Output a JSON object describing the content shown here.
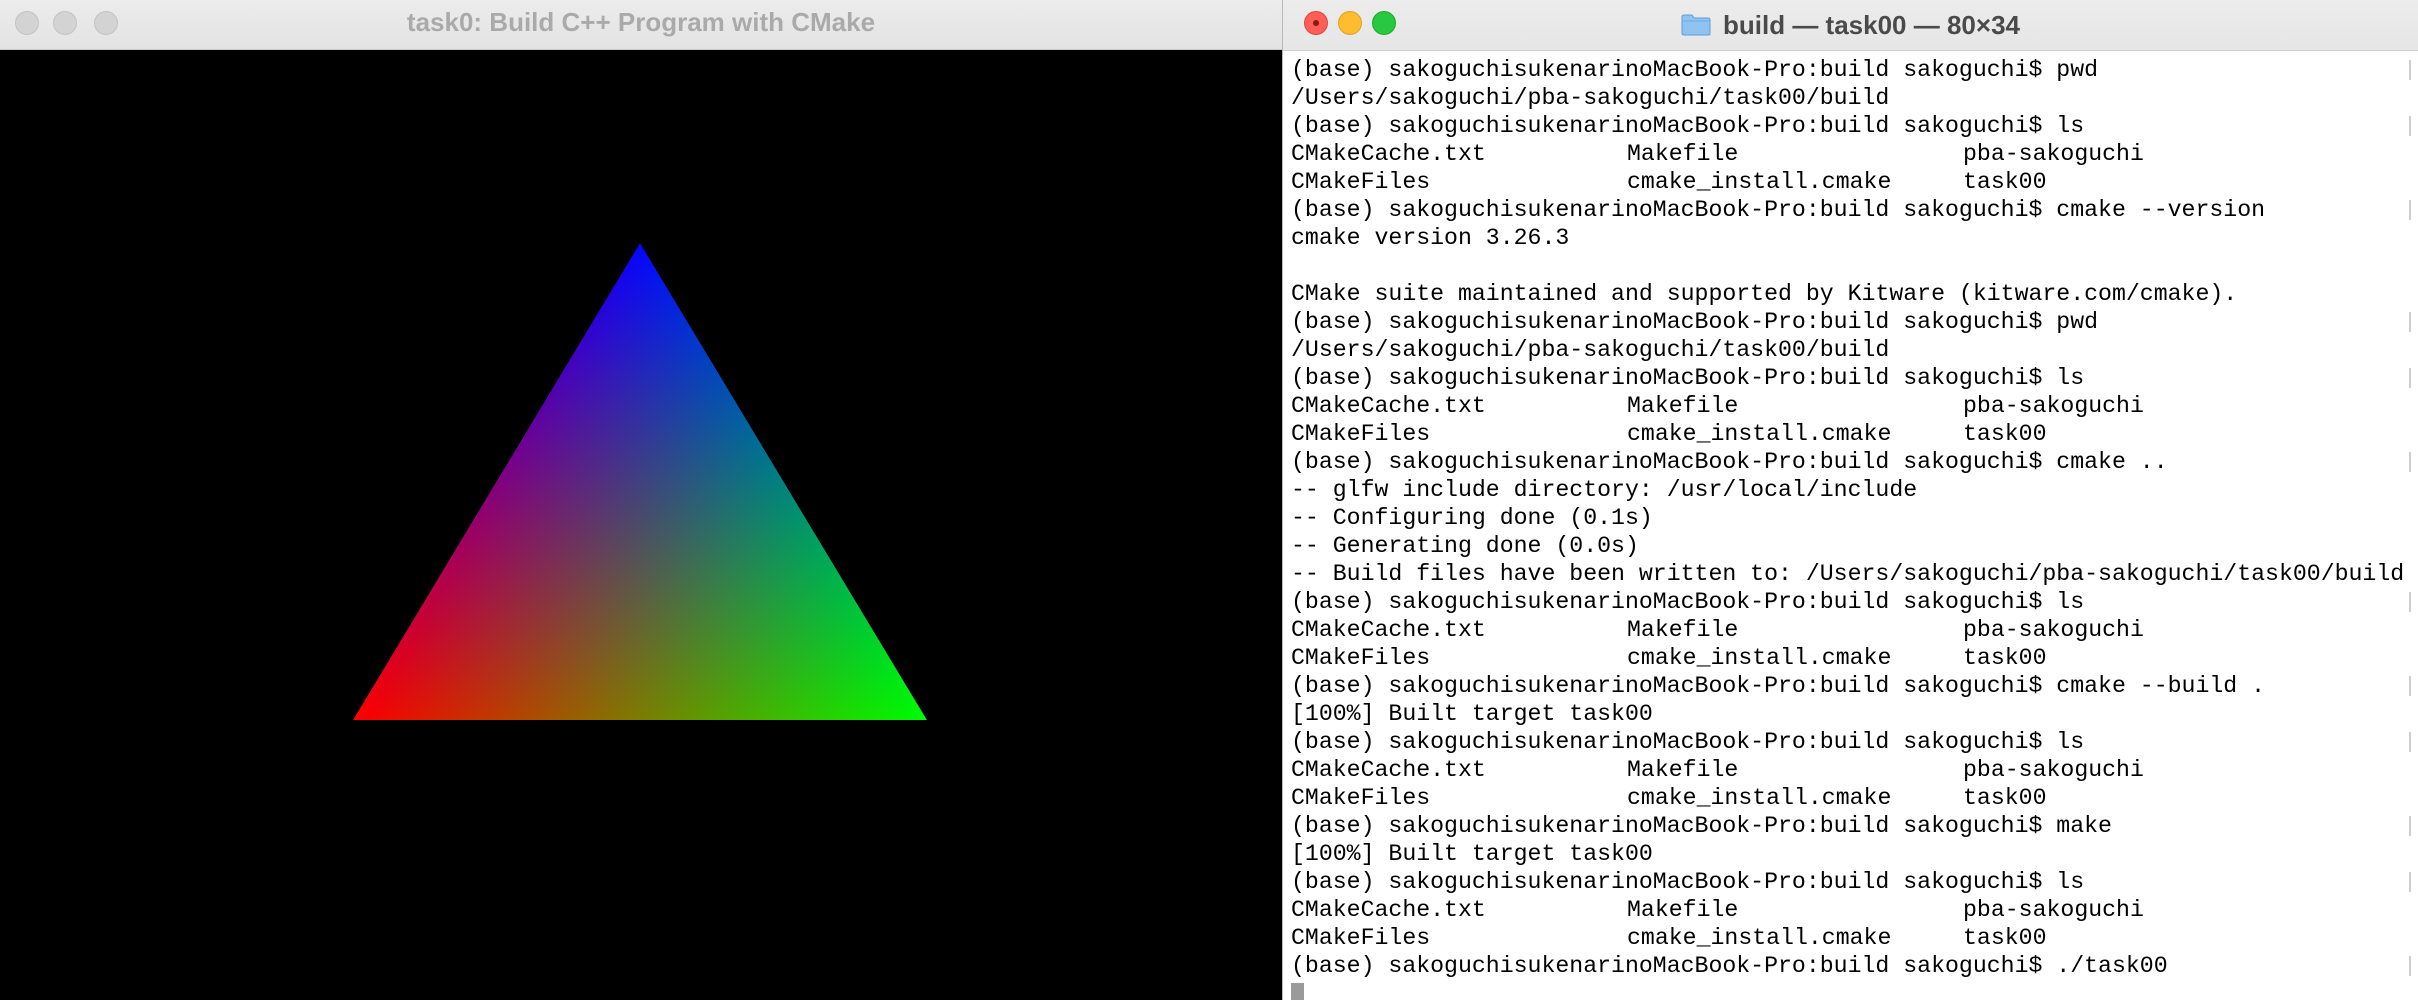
{
  "gl_window": {
    "title": "task0: Build C++ Program with CMake",
    "triangle": {
      "vertex_colors": {
        "top": "#0000ff",
        "left": "#ff0000",
        "right": "#00ff00"
      }
    },
    "background": "#000000"
  },
  "terminal": {
    "title": "build — task00 — 80×34",
    "title_icon": "folder-icon",
    "lines": [
      {
        "type": "prompt",
        "text": "(base) sakoguchisukenarinoMacBook-Pro:build sakoguchi$ pwd"
      },
      {
        "type": "output",
        "text": "/Users/sakoguchi/pba-sakoguchi/task00/build"
      },
      {
        "type": "prompt",
        "text": "(base) sakoguchisukenarinoMacBook-Pro:build sakoguchi$ ls"
      },
      {
        "type": "ls",
        "cells": [
          "CMakeCache.txt",
          "Makefile",
          "pba-sakoguchi"
        ]
      },
      {
        "type": "ls",
        "cells": [
          "CMakeFiles",
          "cmake_install.cmake",
          "task00"
        ]
      },
      {
        "type": "prompt",
        "text": "(base) sakoguchisukenarinoMacBook-Pro:build sakoguchi$ cmake --version"
      },
      {
        "type": "output",
        "text": "cmake version 3.26.3"
      },
      {
        "type": "output",
        "text": ""
      },
      {
        "type": "output",
        "text": "CMake suite maintained and supported by Kitware (kitware.com/cmake)."
      },
      {
        "type": "prompt",
        "text": "(base) sakoguchisukenarinoMacBook-Pro:build sakoguchi$ pwd"
      },
      {
        "type": "output",
        "text": "/Users/sakoguchi/pba-sakoguchi/task00/build"
      },
      {
        "type": "prompt",
        "text": "(base) sakoguchisukenarinoMacBook-Pro:build sakoguchi$ ls"
      },
      {
        "type": "ls",
        "cells": [
          "CMakeCache.txt",
          "Makefile",
          "pba-sakoguchi"
        ]
      },
      {
        "type": "ls",
        "cells": [
          "CMakeFiles",
          "cmake_install.cmake",
          "task00"
        ]
      },
      {
        "type": "prompt",
        "text": "(base) sakoguchisukenarinoMacBook-Pro:build sakoguchi$ cmake .."
      },
      {
        "type": "output",
        "text": "-- glfw include directory: /usr/local/include"
      },
      {
        "type": "output",
        "text": "-- Configuring done (0.1s)"
      },
      {
        "type": "output",
        "text": "-- Generating done (0.0s)"
      },
      {
        "type": "output",
        "text": "-- Build files have been written to: /Users/sakoguchi/pba-sakoguchi/task00/build"
      },
      {
        "type": "prompt",
        "text": "(base) sakoguchisukenarinoMacBook-Pro:build sakoguchi$ ls"
      },
      {
        "type": "ls",
        "cells": [
          "CMakeCache.txt",
          "Makefile",
          "pba-sakoguchi"
        ]
      },
      {
        "type": "ls",
        "cells": [
          "CMakeFiles",
          "cmake_install.cmake",
          "task00"
        ]
      },
      {
        "type": "prompt",
        "text": "(base) sakoguchisukenarinoMacBook-Pro:build sakoguchi$ cmake --build ."
      },
      {
        "type": "output",
        "text": "[100%] Built target task00"
      },
      {
        "type": "prompt",
        "text": "(base) sakoguchisukenarinoMacBook-Pro:build sakoguchi$ ls"
      },
      {
        "type": "ls",
        "cells": [
          "CMakeCache.txt",
          "Makefile",
          "pba-sakoguchi"
        ]
      },
      {
        "type": "ls",
        "cells": [
          "CMakeFiles",
          "cmake_install.cmake",
          "task00"
        ]
      },
      {
        "type": "prompt",
        "text": "(base) sakoguchisukenarinoMacBook-Pro:build sakoguchi$ make"
      },
      {
        "type": "output",
        "text": "[100%] Built target task00"
      },
      {
        "type": "prompt",
        "text": "(base) sakoguchisukenarinoMacBook-Pro:build sakoguchi$ ls"
      },
      {
        "type": "ls",
        "cells": [
          "CMakeCache.txt",
          "Makefile",
          "pba-sakoguchi"
        ]
      },
      {
        "type": "ls",
        "cells": [
          "CMakeFiles",
          "cmake_install.cmake",
          "task00"
        ]
      },
      {
        "type": "prompt",
        "text": "(base) sakoguchisukenarinoMacBook-Pro:build sakoguchi$ ./task00"
      },
      {
        "type": "cursor",
        "text": ""
      }
    ]
  }
}
